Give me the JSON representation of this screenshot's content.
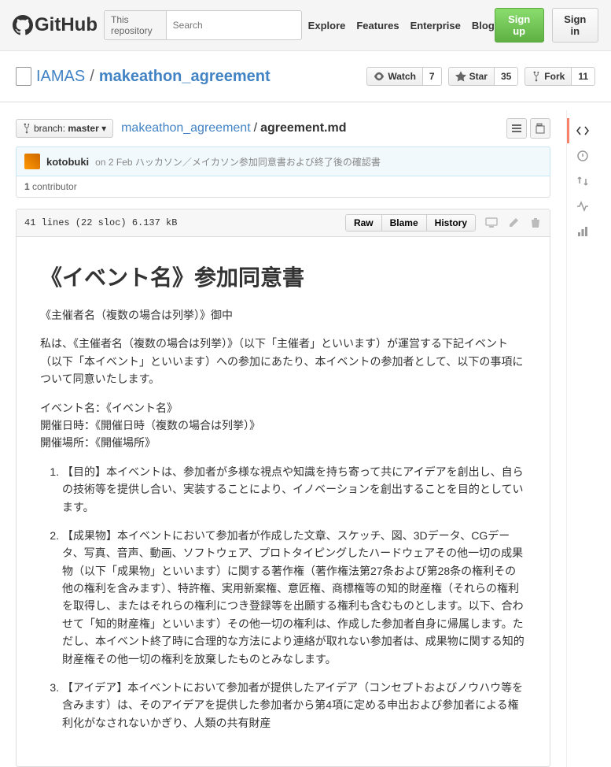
{
  "header": {
    "search_scope": "This repository",
    "search_placeholder": "Search",
    "nav": [
      "Explore",
      "Features",
      "Enterprise",
      "Blog"
    ],
    "signup": "Sign up",
    "signin": "Sign in"
  },
  "repo": {
    "owner": "IAMAS",
    "name": "makeathon_agreement",
    "watch": {
      "label": "Watch",
      "count": "7"
    },
    "star": {
      "label": "Star",
      "count": "35"
    },
    "fork": {
      "label": "Fork",
      "count": "11"
    }
  },
  "filepath": {
    "branch_prefix": "branch:",
    "branch": "master",
    "root": "makeathon_agreement",
    "file": "agreement.md"
  },
  "commit": {
    "author": "kotobuki",
    "date": "on 2 Feb",
    "message": "ハッカソン／メイカソン参加同意書および終了後の確認書",
    "contributors": "1",
    "contributors_label": "contributor"
  },
  "file": {
    "info": "41 lines (22 sloc)   6.137 kB",
    "buttons": [
      "Raw",
      "Blame",
      "History"
    ]
  },
  "doc": {
    "title": "《イベント名》参加同意書",
    "addressee": "《主催者名（複数の場合は列挙）》御中",
    "intro": "私は、《主催者名（複数の場合は列挙）》（以下「主催者」といいます）が運営する下記イベント（以下「本イベント」といいます）への参加にあたり、本イベントの参加者として、以下の事項について同意いたします。",
    "details": {
      "name": "イベント名：《イベント名》",
      "date": "開催日時：《開催日時（複数の場合は列挙）》",
      "place": "開催場所：《開催場所》"
    },
    "items": [
      "【目的】本イベントは、参加者が多様な視点や知識を持ち寄って共にアイデアを創出し、自らの技術等を提供し合い、実装することにより、イノベーションを創出することを目的としています。",
      "【成果物】本イベントにおいて参加者が作成した文章、スケッチ、図、3Dデータ、CGデータ、写真、音声、動画、ソフトウェア、プロトタイピングしたハードウェアその他一切の成果物（以下「成果物」といいます）に関する著作権（著作権法第27条および第28条の権利その他の権利を含みます）、特許権、実用新案権、意匠権、商標権等の知的財産権（それらの権利を取得し、またはそれらの権利につき登録等を出願する権利も含むものとします。以下、合わせて「知的財産権」といいます）その他一切の権利は、作成した参加者自身に帰属します。ただし、本イベント終了時に合理的な方法により連絡が取れない参加者は、成果物に関する知的財産権その他一切の権利を放棄したものとみなします。",
      "【アイデア】本イベントにおいて参加者が提供したアイデア（コンセプトおよびノウハウ等を含みます）は、そのアイデアを提供した参加者から第4項に定める申出および参加者による権利化がなされないかぎり、人類の共有財産"
    ]
  }
}
